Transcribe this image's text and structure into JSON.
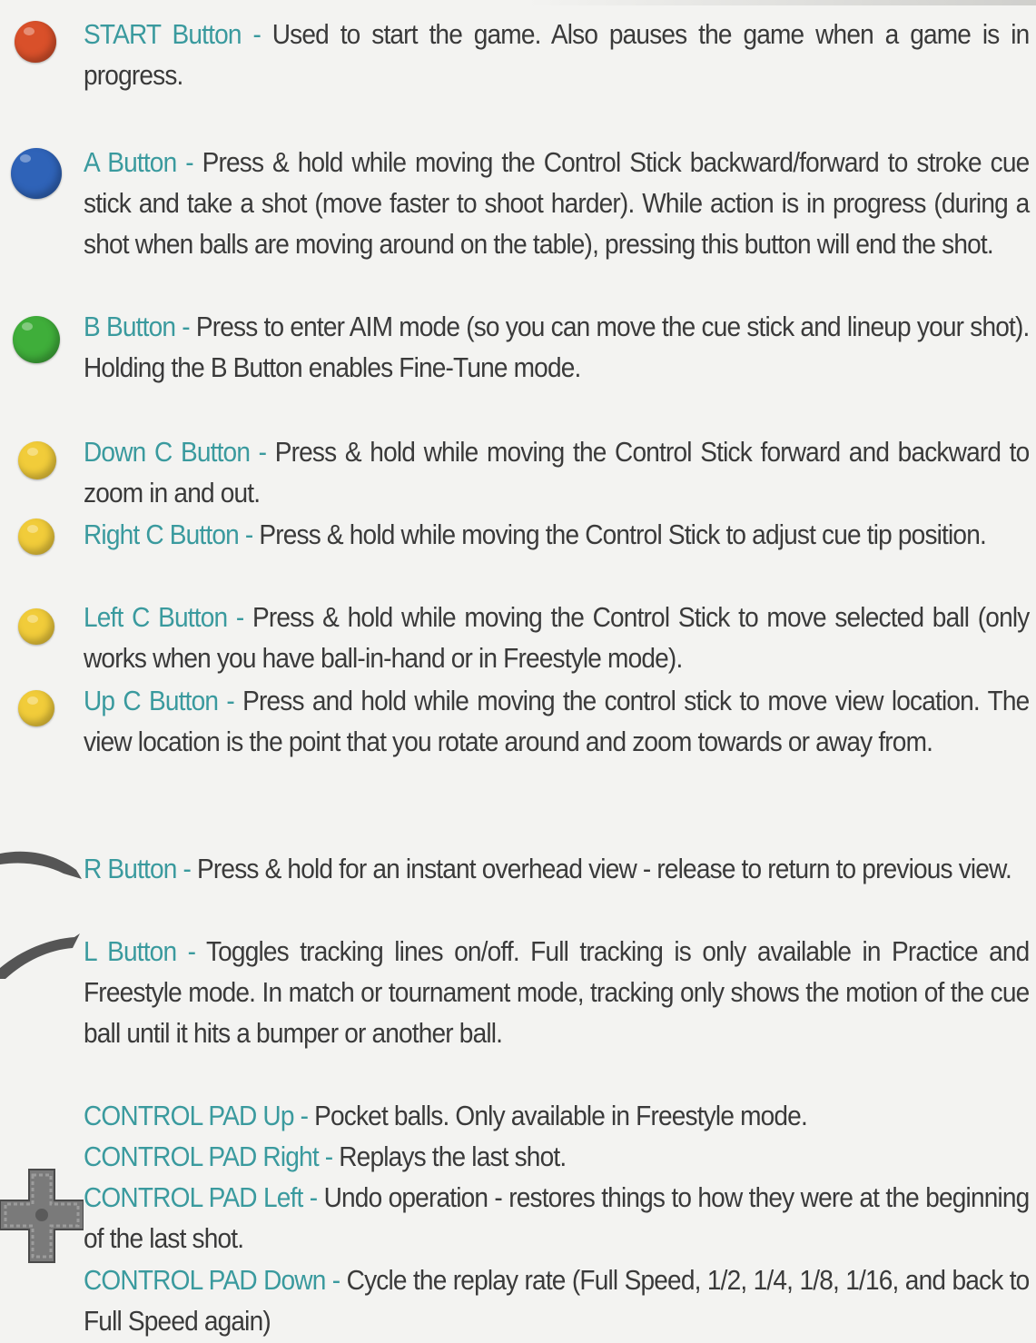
{
  "items": [
    {
      "id": "start",
      "label": "START Button",
      "text": "Used to start the game.  Also pauses the game when a game is in progress."
    },
    {
      "id": "a",
      "label": "A Button",
      "text": "Press & hold while moving the Control Stick backward/forward to stroke cue stick and take a shot (move faster to shoot harder). While action is in progress (during a shot when balls are moving around on the table), pressing this button will end the shot."
    },
    {
      "id": "b",
      "label": "B Button",
      "text": "Press to enter AIM mode (so you can move the cue stick and lineup your shot). Holding the B Button enables Fine-Tune mode."
    },
    {
      "id": "c-down",
      "label": "Down C Button",
      "text": "Press & hold while moving the Control Stick forward and backward to zoom in and out."
    },
    {
      "id": "c-right",
      "label": "Right C Button",
      "text": "Press & hold while moving the Control Stick to adjust cue tip position."
    },
    {
      "id": "c-left",
      "label": "Left C Button",
      "text": "Press & hold while moving the Control Stick to move selected ball (only works when you have ball-in-hand or in Freestyle mode)."
    },
    {
      "id": "c-up",
      "label": "Up C Button",
      "text": "Press and hold while moving the control stick to move view location. The view location is the point that you rotate around and zoom towards or away from."
    },
    {
      "id": "r",
      "label": "R Button",
      "text": "Press &  hold for an instant overhead view - release to return to previous view."
    },
    {
      "id": "l",
      "label": "L Button",
      "text": "Toggles tracking lines on/off. Full tracking is only available in Practice and Freestyle mode.  In match or tournament mode, tracking only shows the motion of the cue ball until it hits a bumper or another ball."
    },
    {
      "id": "pad-up",
      "label": "CONTROL PAD Up",
      "text": "Pocket balls.  Only available in Freestyle mode."
    },
    {
      "id": "pad-right",
      "label": "CONTROL PAD Right",
      "text": "Replays the last shot."
    },
    {
      "id": "pad-left",
      "label": "CONTROL PAD Left",
      "text": "Undo operation - restores things to how they were at the beginning of the last shot."
    },
    {
      "id": "pad-down",
      "label": "CONTROL PAD Down",
      "text": "Cycle the replay rate (Full Speed, 1/2, 1/4, 1/8, 1/16, and back to Full Speed again)"
    }
  ],
  "separator": " - ",
  "icons": {
    "start": {
      "name": "red-ball-icon",
      "color": "#d9502a"
    },
    "a": {
      "name": "blue-ball-icon",
      "color": "#2f63b8"
    },
    "b": {
      "name": "green-ball-icon",
      "color": "#3fae3a"
    },
    "c": {
      "name": "yellow-ball-icon",
      "color": "#f1cc3a"
    },
    "shoulder": {
      "name": "shoulder-trigger-icon",
      "color": "#555555"
    },
    "dpad": {
      "name": "dpad-icon",
      "color": "#6a6a6a"
    }
  }
}
